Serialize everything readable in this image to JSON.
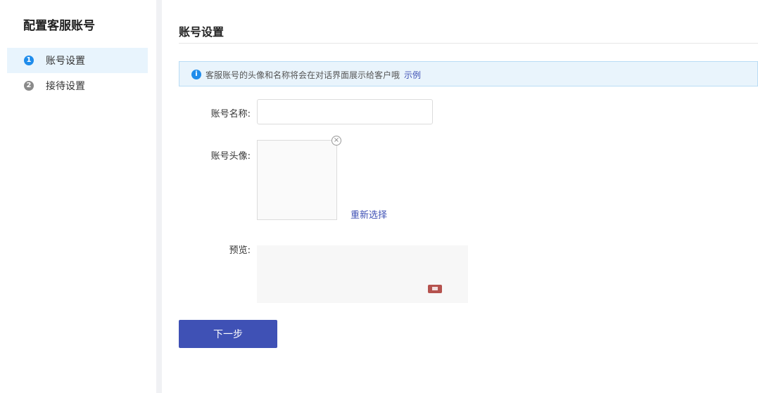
{
  "sidebar": {
    "title": "配置客服账号",
    "items": [
      {
        "number": "1",
        "label": "账号设置"
      },
      {
        "number": "2",
        "label": "接待设置"
      }
    ]
  },
  "main": {
    "title": "账号设置",
    "notice": {
      "icon": "info-icon",
      "text": "客服账号的头像和名称将会在对话界面展示给客户哦",
      "link": "示例"
    },
    "form": {
      "name_label": "账号名称:",
      "name_value": "",
      "avatar_label": "账号头像:",
      "reselect_label": "重新选择",
      "preview_label": "预览:"
    },
    "next_button": "下一步"
  },
  "colors": {
    "accent": "#3f51b5",
    "info_blue": "#1f8ceb",
    "notice_bg": "#e9f4fc"
  }
}
